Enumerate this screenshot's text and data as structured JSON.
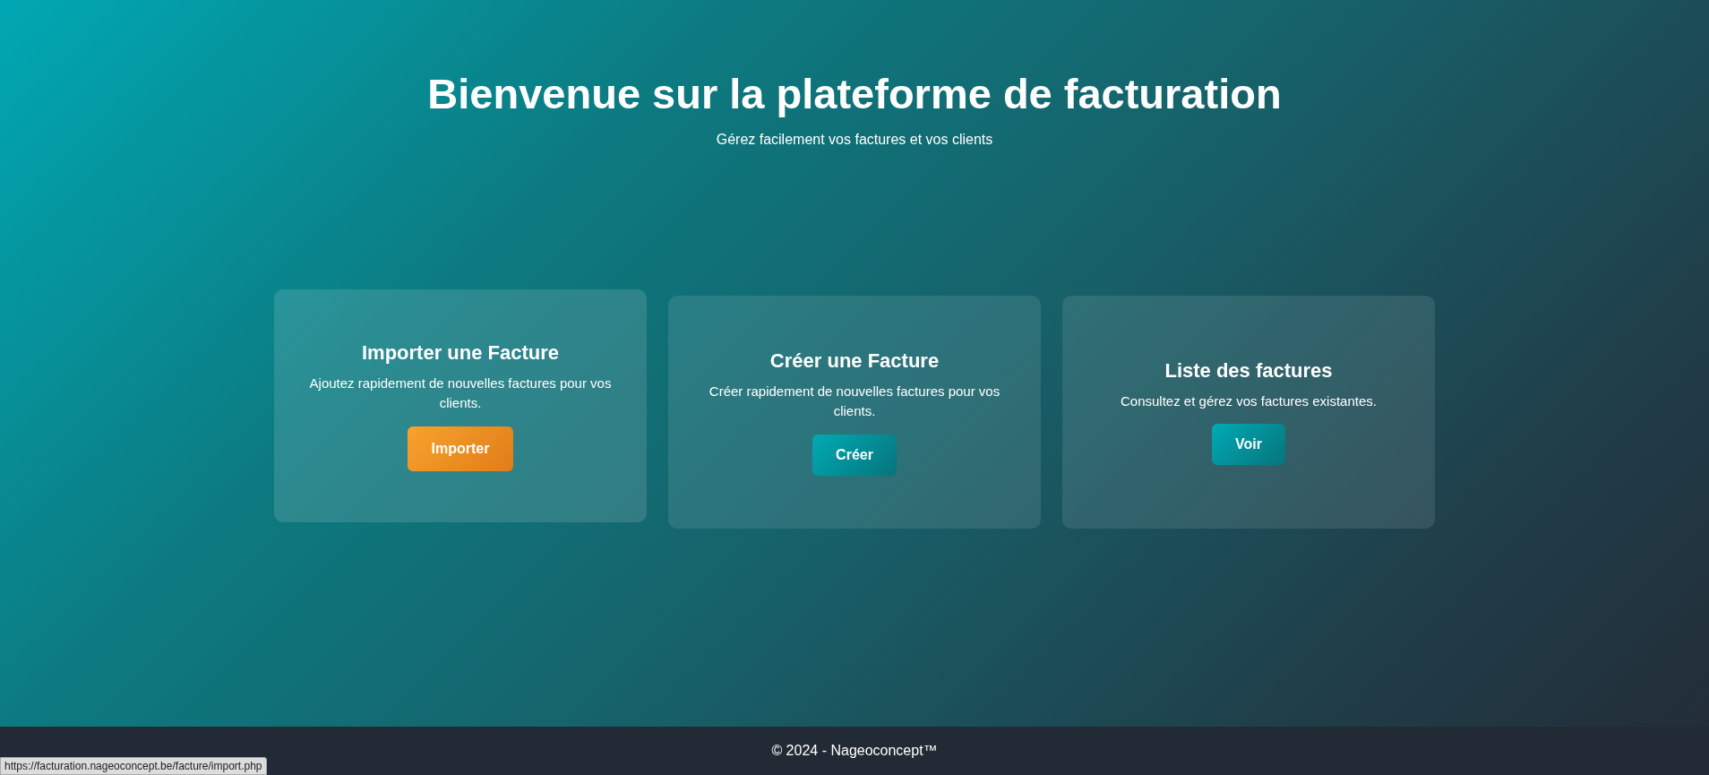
{
  "header": {
    "title": "Bienvenue sur la plateforme de facturation",
    "subtitle": "Gérez facilement vos factures et vos clients"
  },
  "cards": [
    {
      "title": "Importer une Facture",
      "text": "Ajoutez rapidement de nouvelles factures pour vos clients.",
      "button": "Importer",
      "hovered": true
    },
    {
      "title": "Créer une Facture",
      "text": "Créer rapidement de nouvelles factures pour vos clients.",
      "button": "Créer",
      "hovered": false
    },
    {
      "title": "Liste des factures",
      "text": "Consultez et gérez vos factures existantes.",
      "button": "Voir",
      "hovered": false
    }
  ],
  "footer": {
    "text": "© 2024 - Nageoconcept™"
  },
  "status_bar": {
    "url": "https://facturation.nageoconcept.be/facture/import.php"
  }
}
